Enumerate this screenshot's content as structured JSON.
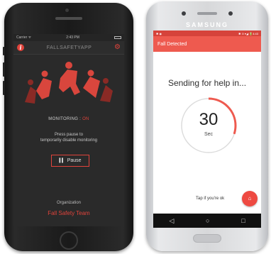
{
  "iphone": {
    "status": {
      "carrier": "Carrier ᯤ",
      "time": "2:43 PM"
    },
    "app_title": "FALLSAFETYAPP",
    "monitoring_label": "MONITORING :",
    "monitoring_state": "ON",
    "pause_note_line1": "Press pause to",
    "pause_note_line2": "temporarily disable monitoring",
    "pause_button": "Pause",
    "organization_label": "Organization",
    "organization_name": "Fall Safety Team",
    "accent": "#e0433b"
  },
  "samsung": {
    "brand": "SAMSUNG",
    "status_right": "✱ ⊙ ▾◢ 🔋4:43",
    "appbar_title": "Fall Detected",
    "heading": "Sending for help in...",
    "countdown_progress": 0.3,
    "countdown_value": "30",
    "countdown_unit": "Sec",
    "tap_label": "Tap if you're ok",
    "accent": "#ee5a4f"
  }
}
